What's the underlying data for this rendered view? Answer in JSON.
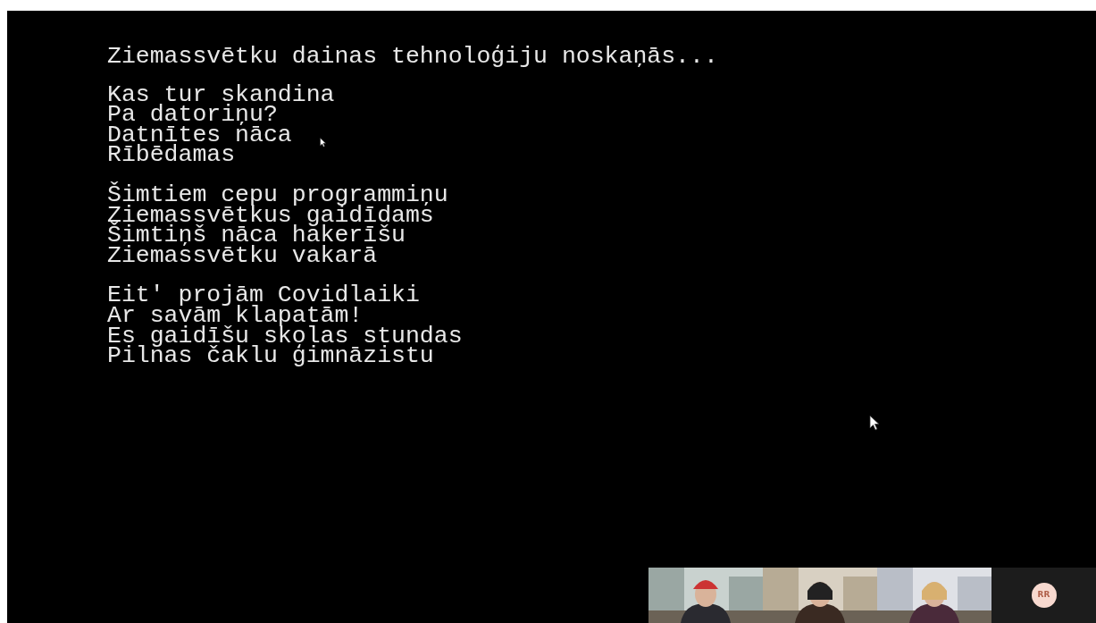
{
  "title": "Ziemassvētku dainas tehnoloģiju noskaņās...",
  "stanzas": [
    {
      "lines": [
        "Kas tur skandina",
        "Pa datoriņu?",
        "Datnītes nāca",
        "Rībēdamas"
      ]
    },
    {
      "lines": [
        "Šimtiem cepu programmiņu",
        "Ziemassvētkus gaidīdams",
        "Šimtiņš nāca hakerīšu",
        "Ziemassvētku vakarā"
      ]
    },
    {
      "lines": [
        "Eit' projām Covidlaiki",
        "Ar savām klapatām!",
        "Es gaidīšu skolas stundas",
        "Pilnas čaklu ģimnāzistu"
      ]
    }
  ],
  "video_tiles": [
    {
      "kind": "picture"
    },
    {
      "kind": "picture"
    },
    {
      "kind": "picture"
    },
    {
      "kind": "avatar",
      "initials": "RR"
    }
  ]
}
